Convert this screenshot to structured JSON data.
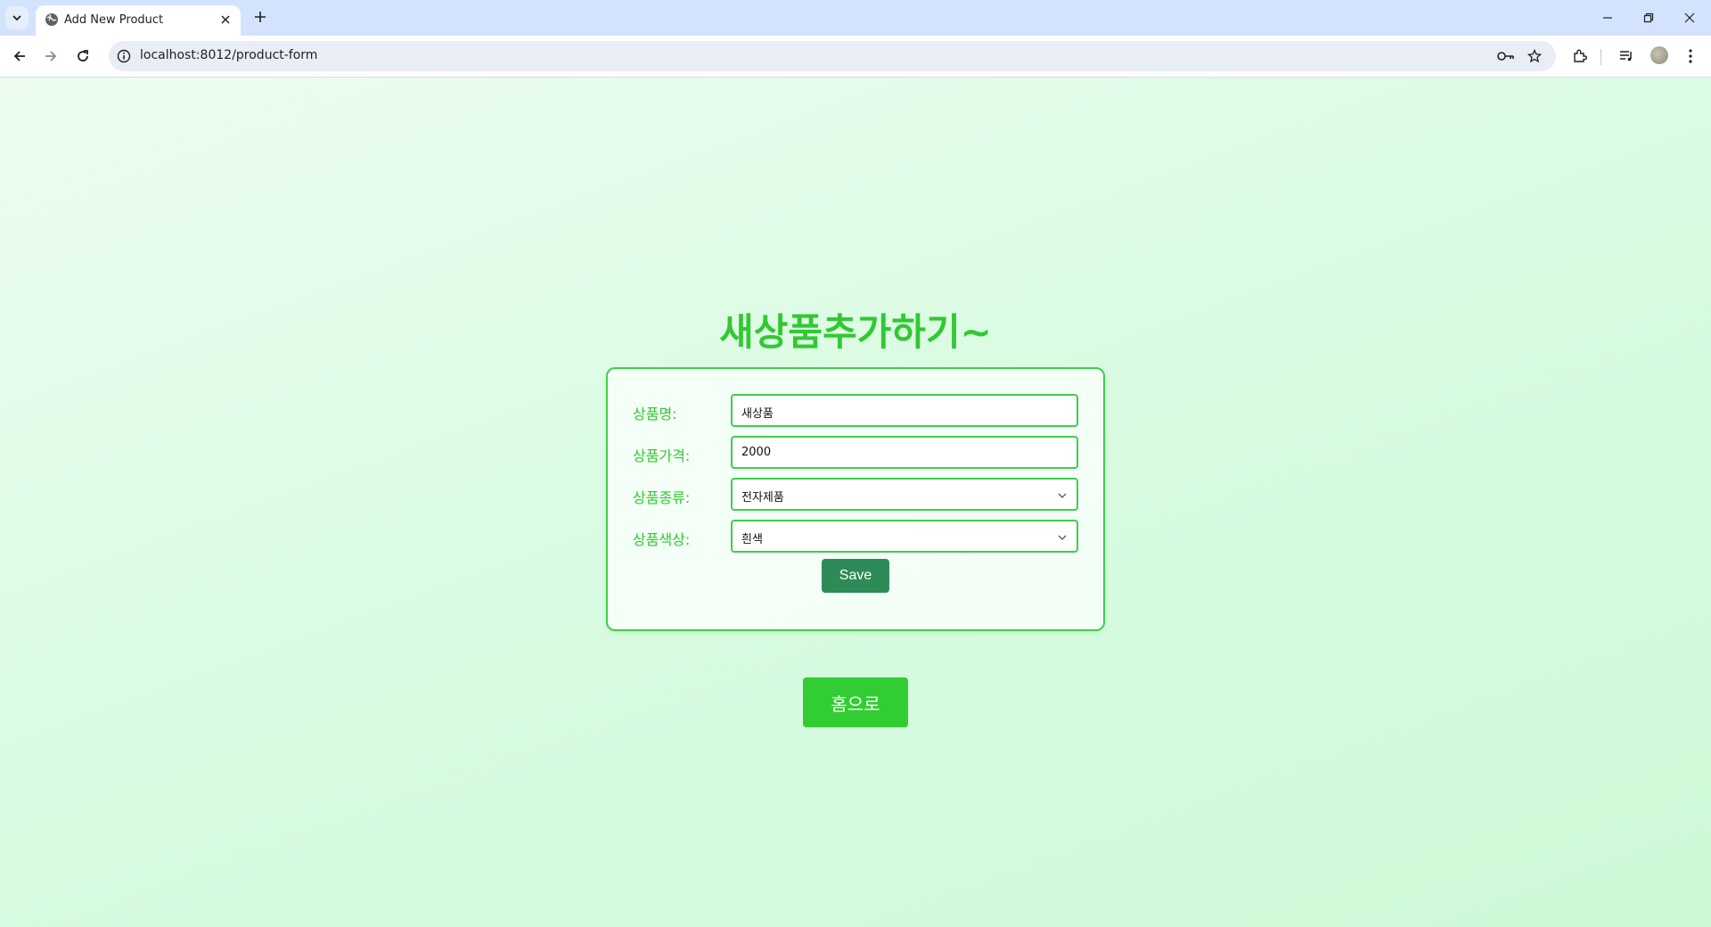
{
  "browser": {
    "tab_title": "Add New Product",
    "url": "localhost:8012/product-form"
  },
  "page": {
    "heading": "새상품추가하기~",
    "form": {
      "fields": [
        {
          "label": "상품명:",
          "value": "새상품",
          "type": "text"
        },
        {
          "label": "상품가격:",
          "value": "2000",
          "type": "text"
        },
        {
          "label": "상품종류:",
          "value": "전자제품",
          "type": "select"
        },
        {
          "label": "상품색상:",
          "value": "흰색",
          "type": "select"
        }
      ],
      "save_label": "Save"
    },
    "home_label": "홈으로"
  },
  "colors": {
    "accent_green": "#32c832",
    "save_button": "#2e8b57",
    "home_button": "#32cd32",
    "tabstrip": "#d3e3fd"
  }
}
